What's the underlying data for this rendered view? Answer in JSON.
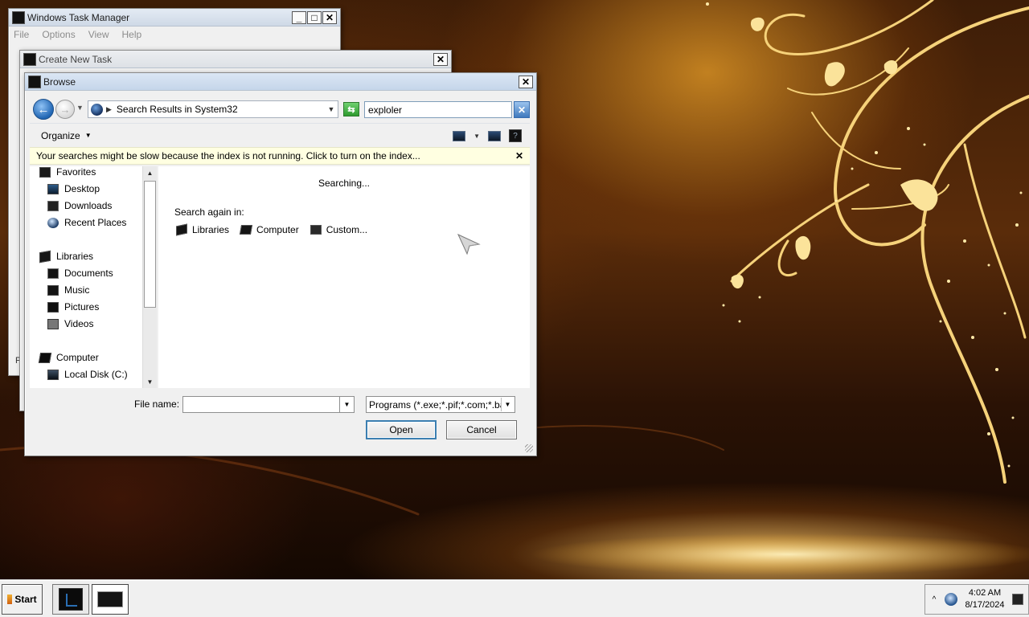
{
  "colors": {
    "wallpaper_dark": "#1a0d04",
    "wallpaper_gold": "#f3c96a",
    "dialog_bg": "#f0f0f0",
    "infobar_bg": "#ffffe1",
    "default_button_border": "#3c7fb1"
  },
  "task_manager": {
    "title": "Windows Task Manager",
    "menu": [
      "File",
      "Options",
      "View",
      "Help"
    ],
    "caption_buttons": [
      "minimize",
      "maximize",
      "close"
    ],
    "stub_text": "P"
  },
  "create_task": {
    "title": "Create New Task"
  },
  "browse": {
    "title": "Browse",
    "address": {
      "location": "Search Results in System32",
      "search_value": "exploler"
    },
    "toolbar": {
      "organize_label": "Organize",
      "view_icons": [
        "change-view-icon",
        "view-options-icon",
        "preview-pane-icon",
        "help-icon"
      ]
    },
    "infobar_text": "Your searches might be slow because the index is not running.  Click to turn on the index...",
    "nav": {
      "favorites": {
        "label": "Favorites",
        "items": [
          "Desktop",
          "Downloads",
          "Recent Places"
        ]
      },
      "libraries": {
        "label": "Libraries",
        "items": [
          "Documents",
          "Music",
          "Pictures",
          "Videos"
        ]
      },
      "computer": {
        "label": "Computer",
        "items": [
          "Local Disk (C:)"
        ]
      }
    },
    "content": {
      "status": "Searching...",
      "search_again_label": "Search again in:",
      "search_again_links": [
        "Libraries",
        "Computer",
        "Custom..."
      ]
    },
    "footer": {
      "file_name_label": "File name:",
      "file_name_value": "",
      "file_type": "Programs (*.exe;*.pif;*.com;*.ba",
      "open_label": "Open",
      "cancel_label": "Cancel"
    }
  },
  "taskbar": {
    "start_label": "Start",
    "apps": [
      {
        "name": "Windows Task Manager",
        "icon": "task-manager-icon",
        "active": false
      },
      {
        "name": "Run",
        "icon": "run-icon",
        "active": true
      }
    ],
    "clock": {
      "time": "4:02 AM",
      "date": "8/17/2024"
    }
  }
}
